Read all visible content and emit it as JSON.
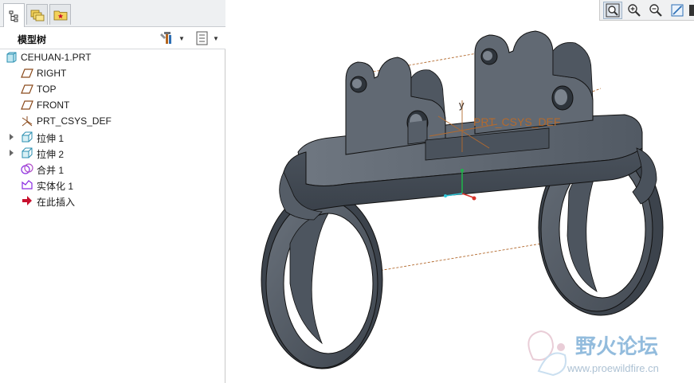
{
  "tabs": [
    {
      "name": "model-tree-tab",
      "icon": "model-tree-icon",
      "active": true
    },
    {
      "name": "folder-browser-tab",
      "icon": "folder-browser-icon",
      "active": false
    },
    {
      "name": "favorites-tab",
      "icon": "favorites-icon",
      "active": false
    }
  ],
  "tree_header": {
    "title": "模型树"
  },
  "tree": [
    {
      "label": "CEHUAN-1.PRT",
      "icon": "part-icon",
      "expandable": false
    },
    {
      "label": "RIGHT",
      "icon": "datum-plane-icon",
      "expandable": false
    },
    {
      "label": "TOP",
      "icon": "datum-plane-icon",
      "expandable": false
    },
    {
      "label": "FRONT",
      "icon": "datum-plane-icon",
      "expandable": false
    },
    {
      "label": "PRT_CSYS_DEF",
      "icon": "csys-icon",
      "expandable": false
    },
    {
      "label": "拉伸 1",
      "icon": "extrude-icon",
      "expandable": true
    },
    {
      "label": "拉伸 2",
      "icon": "extrude-icon",
      "expandable": true
    },
    {
      "label": "合并 1",
      "icon": "merge-icon",
      "expandable": false
    },
    {
      "label": "实体化 1",
      "icon": "solidify-icon",
      "expandable": false
    },
    {
      "label": "在此插入",
      "icon": "insert-here-icon",
      "expandable": false
    }
  ],
  "toolbar": [
    {
      "name": "refit-button",
      "icon": "refit-icon"
    },
    {
      "name": "zoom-in-button",
      "icon": "zoom-in-icon"
    },
    {
      "name": "zoom-out-button",
      "icon": "zoom-out-icon"
    },
    {
      "name": "repaint-button",
      "icon": "repaint-icon"
    }
  ],
  "viewport": {
    "csys_label": "PRT_CSYS_DEF",
    "axis_label": "y",
    "model_color": "#5b6470",
    "datum_color": "#b36a2e"
  },
  "watermark": {
    "cn": "野火论坛",
    "url": "www.proewildfire.cn"
  },
  "colors": {
    "accent": "#1e88c8",
    "watermark": "#3b86c2"
  }
}
